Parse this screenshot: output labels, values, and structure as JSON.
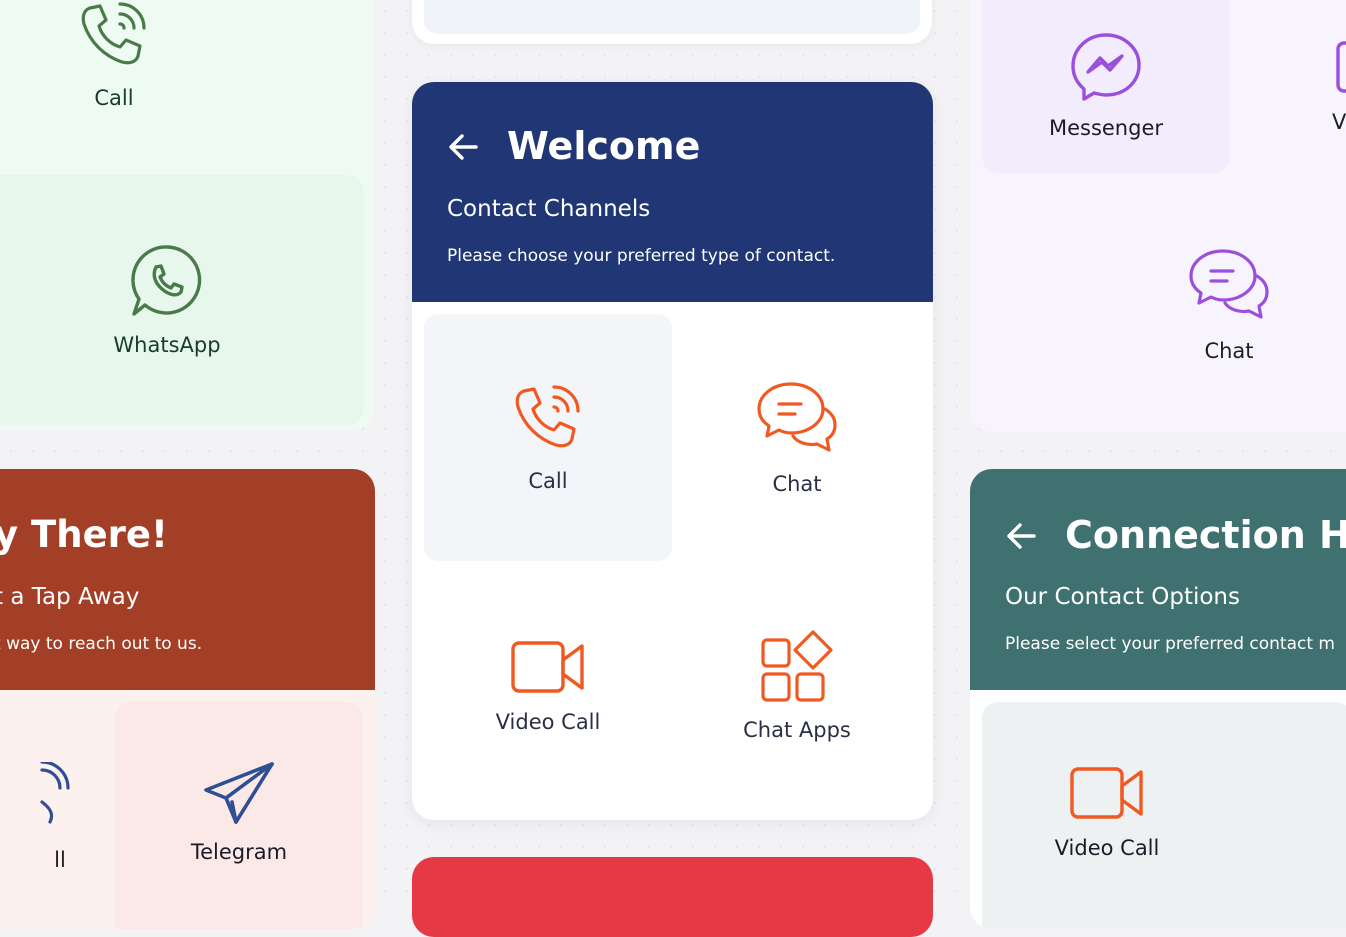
{
  "colors": {
    "welcome_header": "#213674",
    "welcome_accent": "#f05a22",
    "left_green_card": "#ecfaf1",
    "left_green_text": "#173d22",
    "left_icon_green": "#4a7a49",
    "red_header": "#a33f27",
    "teal_header": "#3f7170",
    "purple_card": "#f7f3fd",
    "purple_icon": "#9b4fdd",
    "bottom_red": "#e63946"
  },
  "left_top_card": {
    "call_label": "Call",
    "whatsapp_label": "WhatsApp"
  },
  "left_bottom_card": {
    "title": "y There!",
    "subtitle": "t a Tap Away",
    "description": "t way to reach out to us.",
    "call_label": "ll",
    "telegram_label": "Telegram"
  },
  "welcome_card": {
    "title": "Welcome",
    "subtitle": "Contact Channels",
    "description": "Please choose your preferred type of contact.",
    "tiles": [
      {
        "label": "Call",
        "icon": "phone-icon"
      },
      {
        "label": "Chat",
        "icon": "chat-icon"
      },
      {
        "label": "Video Call",
        "icon": "video-icon"
      },
      {
        "label": "Chat Apps",
        "icon": "apps-icon"
      }
    ]
  },
  "right_top_card": {
    "messenger_label": "Messenger",
    "video_label": "Vide",
    "chat_label": "Chat"
  },
  "right_bottom_card": {
    "title": "Connection Hub",
    "subtitle": "Our Contact Options",
    "description": "Please select your preferred contact m",
    "video_label": "Video Call"
  }
}
